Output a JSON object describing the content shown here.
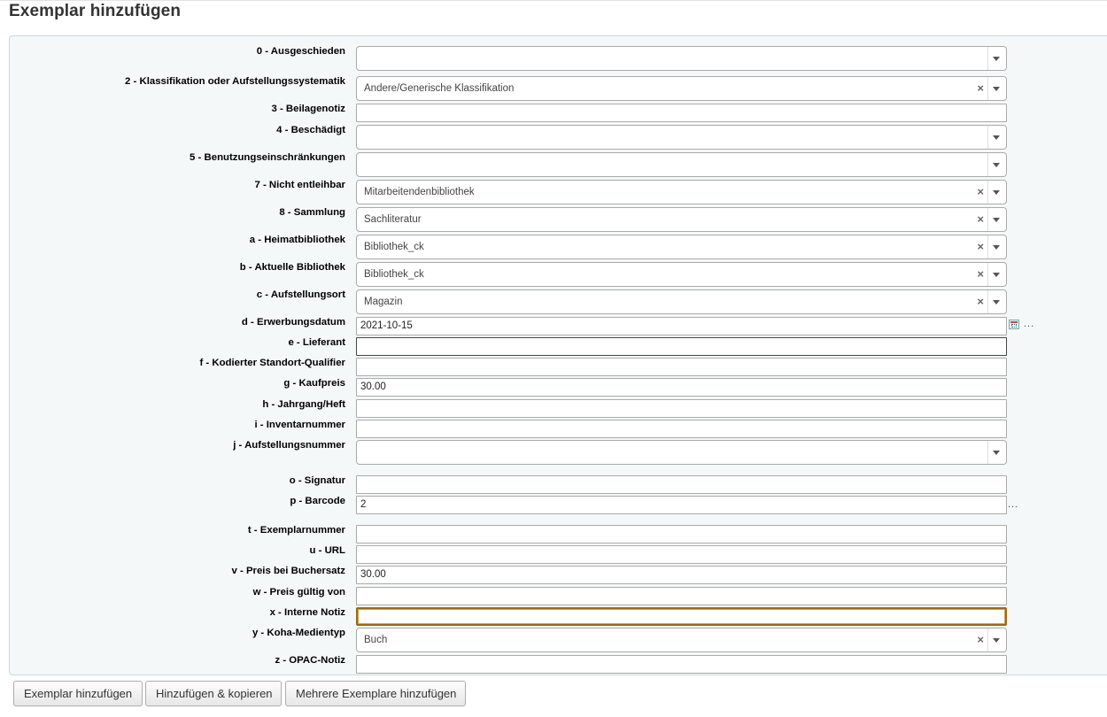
{
  "page": {
    "title": "Exemplar hinzufügen"
  },
  "fields": {
    "f0": {
      "label": "0 - Ausgeschieden",
      "value": ""
    },
    "f2": {
      "label": "2 - Klassifikation oder Aufstellungssystematik",
      "value": "Andere/Generische Klassifikation"
    },
    "f3": {
      "label": "3 - Beilagenotiz",
      "value": ""
    },
    "f4": {
      "label": "4 - Beschädigt",
      "value": ""
    },
    "f5": {
      "label": "5 - Benutzungseinschränkungen",
      "value": ""
    },
    "f7": {
      "label": "7 - Nicht entleihbar",
      "value": "Mitarbeitendenbibliothek"
    },
    "f8": {
      "label": "8 - Sammlung",
      "value": "Sachliteratur"
    },
    "fa": {
      "label": "a - Heimatbibliothek",
      "value": "Bibliothek_ck"
    },
    "fb": {
      "label": "b - Aktuelle Bibliothek",
      "value": "Bibliothek_ck"
    },
    "fc": {
      "label": "c - Aufstellungsort",
      "value": "Magazin"
    },
    "fd": {
      "label": "d - Erwerbungsdatum",
      "value": "2021-10-15",
      "extra": "..."
    },
    "fe": {
      "label": "e - Lieferant",
      "value": ""
    },
    "ff": {
      "label": "f - Kodierter Standort-Qualifier",
      "value": ""
    },
    "fg": {
      "label": "g - Kaufpreis",
      "value": "30.00"
    },
    "fh": {
      "label": "h - Jahrgang/Heft",
      "value": ""
    },
    "fi": {
      "label": "i - Inventarnummer",
      "value": ""
    },
    "fj": {
      "label": "j - Aufstellungsnummer",
      "value": ""
    },
    "fo": {
      "label": "o - Signatur",
      "value": ""
    },
    "fp": {
      "label": "p - Barcode",
      "value": "2",
      "extra": "..."
    },
    "ft": {
      "label": "t - Exemplarnummer",
      "value": ""
    },
    "fu": {
      "label": "u - URL",
      "value": ""
    },
    "fv": {
      "label": "v - Preis bei Buchersatz",
      "value": "30.00"
    },
    "fw": {
      "label": "w - Preis gültig von",
      "value": ""
    },
    "fx": {
      "label": "x - Interne Notiz",
      "value": ""
    },
    "fy": {
      "label": "y - Koha-Medientyp",
      "value": "Buch"
    },
    "fz": {
      "label": "z - OPAC-Notiz",
      "value": ""
    }
  },
  "select_clear_glyph": "×",
  "buttons": {
    "add": "Exemplar hinzufügen",
    "add_copy": "Hinzufügen & kopieren",
    "add_multiple": "Mehrere Exemplare hinzufügen"
  }
}
